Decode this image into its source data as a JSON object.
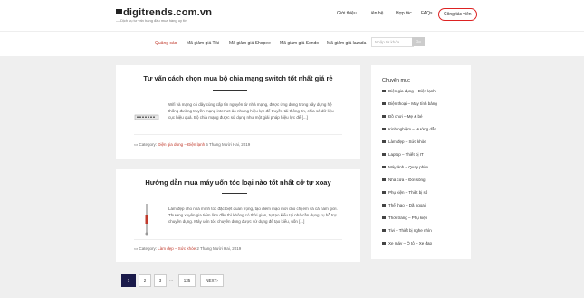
{
  "header": {
    "logo_text": "digitrends.com.vn",
    "tagline": "— Dịch vụ tư vấn hàng đầu mua hàng uy tín",
    "nav": [
      "Giới thiệu",
      "Liên hệ",
      "Hợp tác",
      "FAQs"
    ],
    "contact_label": "Công tác viên",
    "accent": "#d22222"
  },
  "subnav": {
    "items": [
      "Quảng cáo",
      "Mã giảm giá Tiki",
      "Mã giảm giá Shopee",
      "Mã giảm giá Sendo",
      "Mã giảm giá lazada"
    ],
    "active_index": 0,
    "search_placeholder": "Nhập từ khóa...",
    "search_button": "Go"
  },
  "posts": [
    {
      "title": "Tư vấn cách chọn mua bộ chia mạng switch tốt nhất giá rẻ",
      "excerpt": "Wifi và mạng có dây cùng cấp tín nguyên từ nhà mạng, được ứng dụng trong xây dựng hệ thống đường truyền mạng internet ảo nhưng hiệu lực để truyền tải thông tin, chia sẻ dữ liệu cục hiệu quả. Bộ chia mạng được sử dụng như một giải pháp hiệu lực để [...]",
      "category_label": "Category:",
      "category": "Điện gia dụng – Điện lạnh",
      "date": "5 Tháng Mười Hai, 2019",
      "thumb_icon": "network-switch-image"
    },
    {
      "title": "Hướng dẫn mua máy uốn tóc loại nào tốt nhất cỡ tự xoay",
      "excerpt": "Làm đẹp cho nhà mình tóc đặc biệt quan trọng, tạo điểm mạo mới cho chị em và cả nam giới. Thương xuyên gia tiểm làm đầu thì không có thời gian, tự tạo kiểu tại nhà cần dụng cụ hỗ trợ chuyên dụng. Máy uốn tóc chuyên dụng được sử dụng để tạo kiểu, uốn [...]",
      "category_label": "Category:",
      "category": "Làm đẹp – Sức khỏe",
      "date": "2 Tháng Mười Hai, 2019",
      "thumb_icon": "hair-curler-image"
    }
  ],
  "pagination": {
    "pages": [
      "1",
      "2",
      "3"
    ],
    "dots": "...",
    "last": "135",
    "next": "NEXT›",
    "active_index": 0
  },
  "sidebar": {
    "heading": "Chuyên mục",
    "items": [
      {
        "label": "Điện gia dụng – Điện lạnh",
        "icon": "appliance-icon"
      },
      {
        "label": "Điện thoại – Máy tính bảng",
        "icon": "phone-icon"
      },
      {
        "label": "Đồ chơi – Mẹ & bé",
        "icon": "toy-icon"
      },
      {
        "label": "Kinh nghiệm – Hướng dẫn",
        "icon": "book-icon"
      },
      {
        "label": "Làm đẹp – Sức khỏe",
        "icon": "heart-icon"
      },
      {
        "label": "Laptop – Thiết bị IT",
        "icon": "laptop-icon"
      },
      {
        "label": "Máy ảnh – Quay phim",
        "icon": "camera-icon"
      },
      {
        "label": "Nhà cửa – Đời sống",
        "icon": "home-icon"
      },
      {
        "label": "Phụ kiện – Thiết bị số",
        "icon": "headphone-icon"
      },
      {
        "label": "Thể thao – Dã ngoại",
        "icon": "sport-icon"
      },
      {
        "label": "Thời trang – Phụ kiện",
        "icon": "fashion-icon"
      },
      {
        "label": "Tivi – Thiết bị nghe nhìn",
        "icon": "tv-icon"
      },
      {
        "label": "Xe máy – Ô tô – Xe đạp",
        "icon": "bike-icon"
      }
    ]
  }
}
